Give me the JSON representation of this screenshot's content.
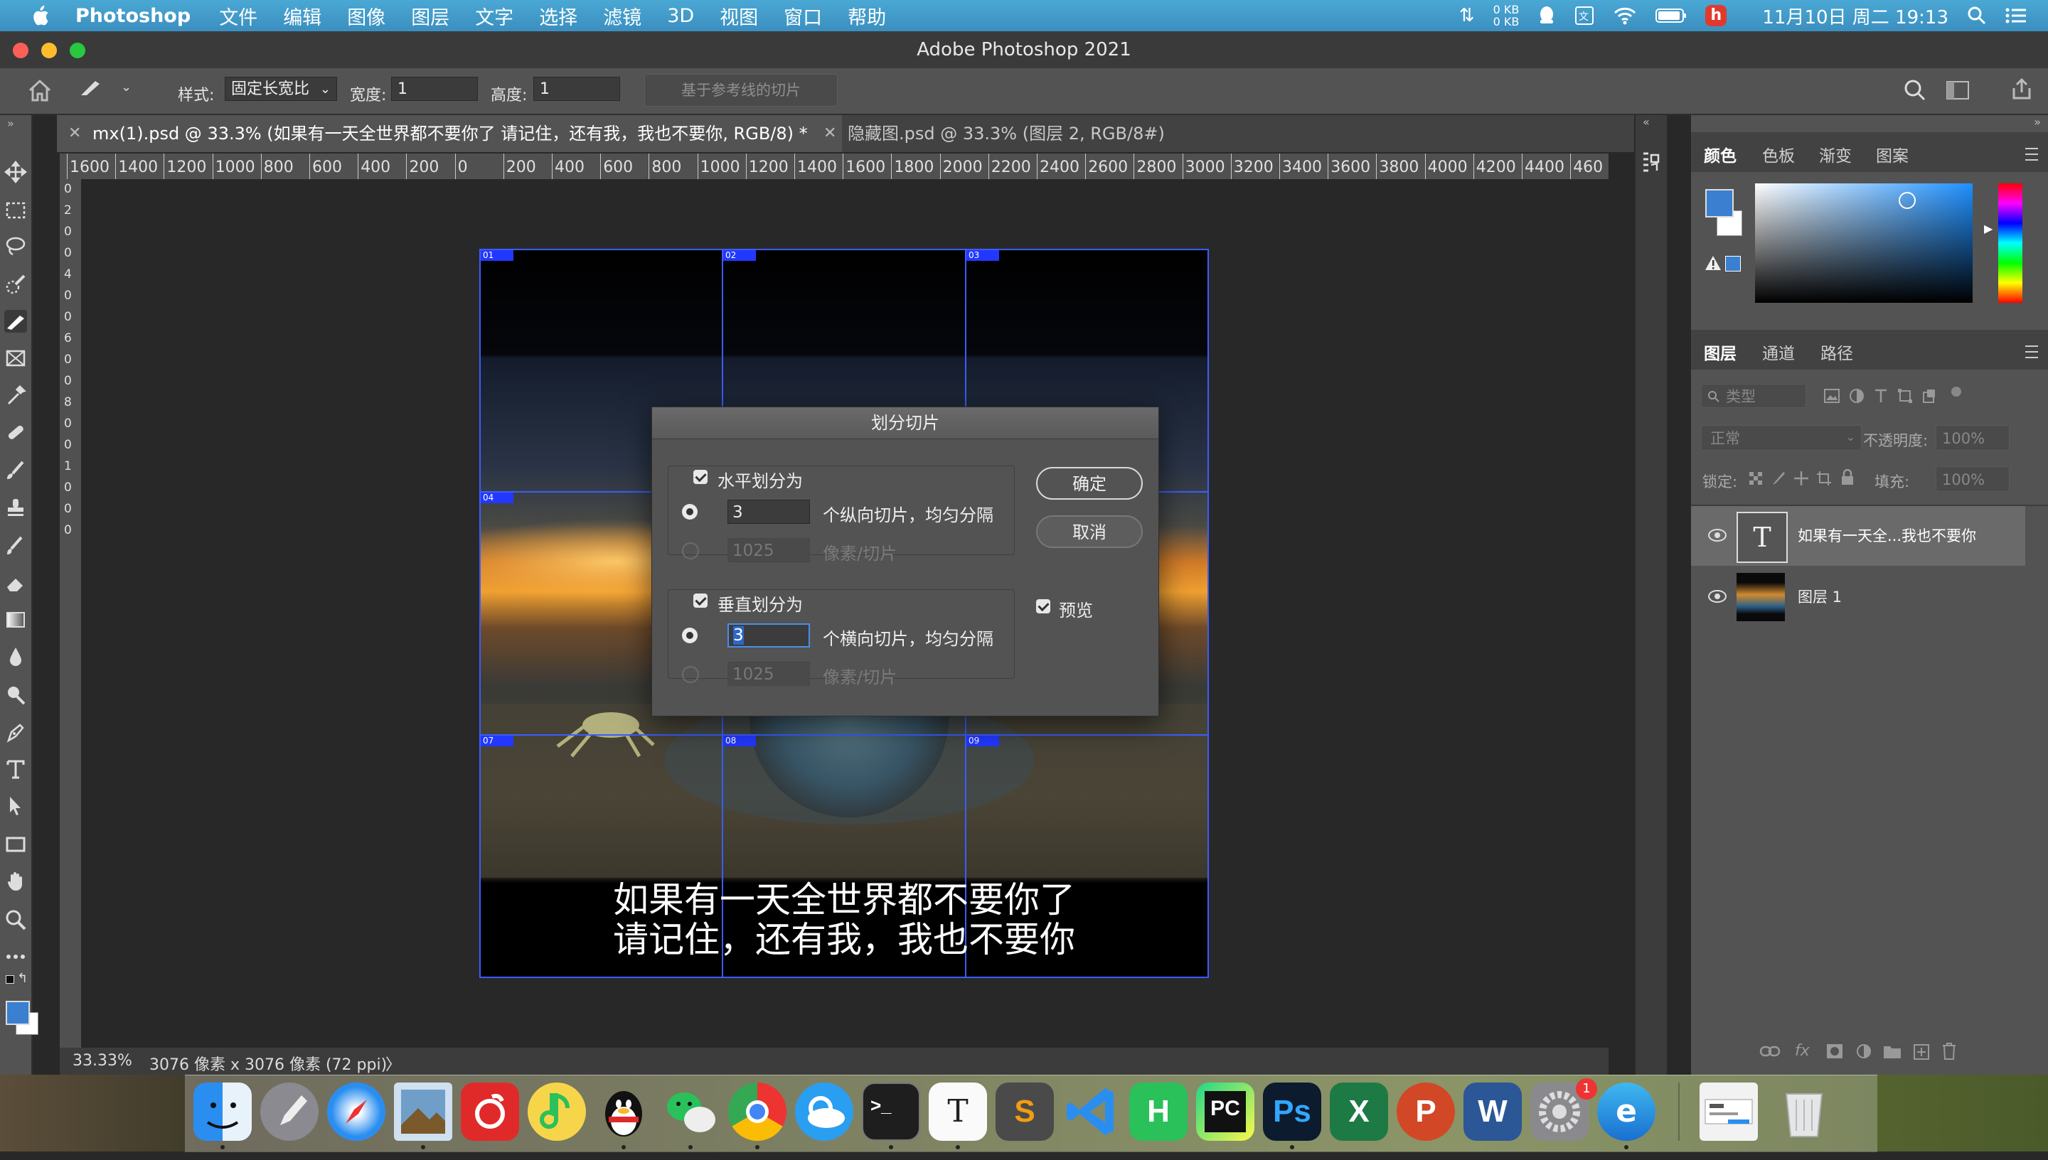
{
  "menubar": {
    "app_name": "Photoshop",
    "items": [
      "文件",
      "编辑",
      "图像",
      "图层",
      "文字",
      "选择",
      "滤镜",
      "3D",
      "视图",
      "窗口",
      "帮助"
    ],
    "net_up": "0 KB",
    "net_down": "0 KB",
    "badge": "h",
    "datetime": "11月10日 周二  19:13"
  },
  "window": {
    "title": "Adobe Photoshop 2021"
  },
  "options": {
    "style_label": "样式:",
    "style_value": "固定长宽比",
    "width_label": "宽度:",
    "width_value": "1",
    "height_label": "高度:",
    "height_value": "1",
    "guides_button": "基于参考线的切片"
  },
  "tabs": [
    {
      "label": "mx(1).psd @ 33.3% (如果有一天全世界都不要你了 请记住，还有我，我也不要你, RGB/8) *"
    },
    {
      "label": "隐藏图.psd @ 33.3% (图层 2, RGB/8#)"
    }
  ],
  "ruler": {
    "h_labels": [
      "1600",
      "1400",
      "1200",
      "1000",
      "800",
      "600",
      "400",
      "200",
      "0",
      "200",
      "400",
      "600",
      "800",
      "1000",
      "1200",
      "1400",
      "1600",
      "1800",
      "2000",
      "2200",
      "2400",
      "2600",
      "2800",
      "3000",
      "3200",
      "3400",
      "3600",
      "3800",
      "4000",
      "4200",
      "4400",
      "460"
    ],
    "v_labels": [
      "0",
      "2",
      "0",
      "0",
      "4",
      "0",
      "0",
      "6",
      "0",
      "0",
      "8",
      "0",
      "0",
      "1",
      "0",
      "0",
      "0"
    ]
  },
  "canvas": {
    "slices": [
      "01",
      "02",
      "03",
      "04",
      "07",
      "08",
      "09"
    ],
    "caption_line1": "如果有一天全世界都不要你了",
    "caption_line2": "请记住，还有我，我也不要你"
  },
  "status": {
    "zoom": "33.33%",
    "info": "3076 像素 x 3076 像素 (72 ppi)",
    "arrow": "〉"
  },
  "dialog": {
    "title": "划分切片",
    "horizontal": {
      "label": "水平划分为",
      "count_value": "3",
      "count_text": "个纵向切片，均匀分隔",
      "pixels_value": "1025",
      "pixels_text": "像素/切片"
    },
    "vertical": {
      "label": "垂直划分为",
      "count_value": "3",
      "count_text": "个横向切片，均匀分隔",
      "pixels_value": "1025",
      "pixels_text": "像素/切片"
    },
    "ok": "确定",
    "cancel": "取消",
    "preview": "预览"
  },
  "color_panel": {
    "tabs": [
      "颜色",
      "色板",
      "渐变",
      "图案"
    ],
    "fg_color": "#3a7fd0"
  },
  "layers_panel": {
    "tabs": [
      "图层",
      "通道",
      "路径"
    ],
    "filter_label": "类型",
    "blend_mode": "正常",
    "opacity_label": "不透明度:",
    "opacity_value": "100%",
    "lock_label": "锁定:",
    "fill_label": "填充:",
    "fill_value": "100%",
    "layers": [
      {
        "name": "如果有一天全...我也不要你",
        "type": "text",
        "thumb_letter": "T"
      },
      {
        "name": "图层 1",
        "type": "image"
      }
    ],
    "footer_fx": "fx"
  },
  "dock": {
    "apps": [
      "Finder",
      "Launchpad",
      "Safari",
      "Preview",
      "NetEase Music",
      "QQ Music",
      "QQ",
      "WeChat",
      "Chrome",
      "Cloud",
      "Terminal",
      "Typora",
      "Sublime",
      "VS Code",
      "HBuilder",
      "PyCharm",
      "Photoshop",
      "Excel",
      "PowerPoint",
      "Word",
      "System Preferences",
      "Edge",
      "Screenshot",
      "Trash"
    ],
    "labels": {
      "terminal": ">_",
      "typora": "T",
      "sublime": "S",
      "hbuilder": "H",
      "pycharm": "PC",
      "photoshop": "Ps",
      "excel": "X",
      "ppt": "P",
      "word": "W",
      "edge": "e",
      "notif": "1"
    }
  }
}
